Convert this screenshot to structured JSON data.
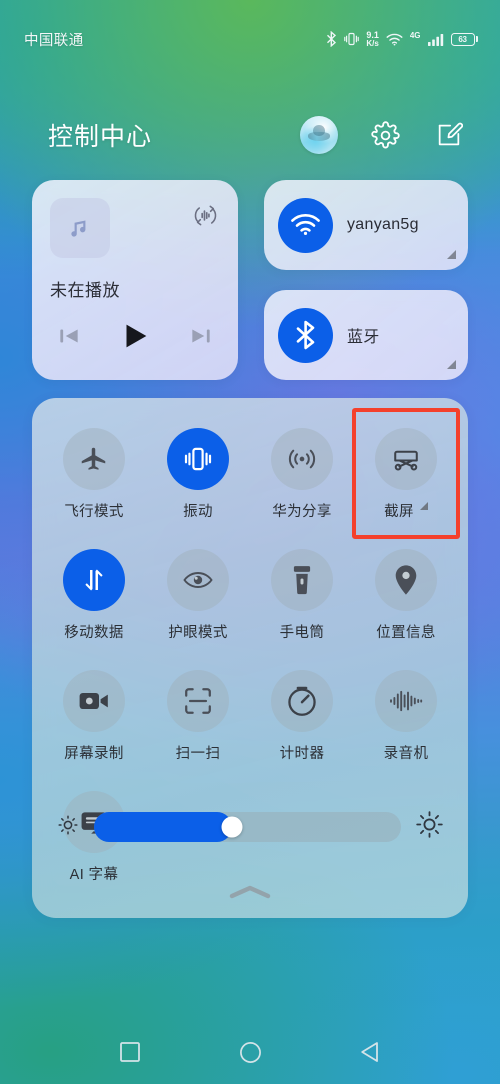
{
  "status_bar": {
    "carrier": "中国联通",
    "net_speed_value": "9.1",
    "net_speed_unit": "K/s",
    "network_type": "4G",
    "battery_percent": "63",
    "icons": [
      "bluetooth-icon",
      "vibrate-icon",
      "wifi-icon",
      "signal-icon",
      "battery-icon"
    ]
  },
  "header": {
    "title": "控制中心",
    "avatar_name": "user-avatar",
    "settings_icon": "gear-icon",
    "edit_icon": "edit-icon"
  },
  "media": {
    "thumbnail_icon": "music-note-icon",
    "cast_icon": "audio-output-icon",
    "title": "未在播放",
    "prev_label": "previous-track",
    "play_label": "play",
    "next_label": "next-track"
  },
  "connectivity": [
    {
      "icon": "wifi-icon",
      "label": "yanyan5g",
      "active": true
    },
    {
      "icon": "bluetooth-icon",
      "label": "蓝牙",
      "active": true
    }
  ],
  "toggles": [
    {
      "label": "飞行模式",
      "icon": "airplane-icon",
      "active": false,
      "expandable": false,
      "highlighted": false
    },
    {
      "label": "振动",
      "icon": "vibrate-icon",
      "active": true,
      "expandable": false,
      "highlighted": false
    },
    {
      "label": "华为分享",
      "icon": "huawei-share-icon",
      "active": false,
      "expandable": false,
      "highlighted": false
    },
    {
      "label": "截屏",
      "icon": "screenshot-icon",
      "active": false,
      "expandable": true,
      "highlighted": true
    },
    {
      "label": "移动数据",
      "icon": "mobile-data-icon",
      "active": true,
      "expandable": false,
      "highlighted": false
    },
    {
      "label": "护眼模式",
      "icon": "eye-comfort-icon",
      "active": false,
      "expandable": false,
      "highlighted": false
    },
    {
      "label": "手电筒",
      "icon": "flashlight-icon",
      "active": false,
      "expandable": false,
      "highlighted": false
    },
    {
      "label": "位置信息",
      "icon": "location-icon",
      "active": false,
      "expandable": false,
      "highlighted": false
    },
    {
      "label": "屏幕录制",
      "icon": "screen-record-icon",
      "active": false,
      "expandable": false,
      "highlighted": false
    },
    {
      "label": "扫一扫",
      "icon": "scan-icon",
      "active": false,
      "expandable": false,
      "highlighted": false
    },
    {
      "label": "计时器",
      "icon": "timer-icon",
      "active": false,
      "expandable": false,
      "highlighted": false
    },
    {
      "label": "录音机",
      "icon": "recorder-icon",
      "active": false,
      "expandable": false,
      "highlighted": false
    },
    {
      "label": "AI 字幕",
      "icon": "ai-subtitle-icon",
      "active": false,
      "expandable": false,
      "highlighted": false
    }
  ],
  "brightness": {
    "min_icon": "brightness-low-icon",
    "max_icon": "brightness-high-icon",
    "value_percent": 45,
    "expand_icon": "chevron-up-icon"
  },
  "navbar": {
    "recents": "recents-button",
    "home": "home-button",
    "back": "back-button"
  },
  "colors": {
    "accent_blue": "#0b5fe8",
    "highlight_red": "#f4402c",
    "panel_bg": "#bdd7de",
    "card_bg": "#eeeffa"
  }
}
